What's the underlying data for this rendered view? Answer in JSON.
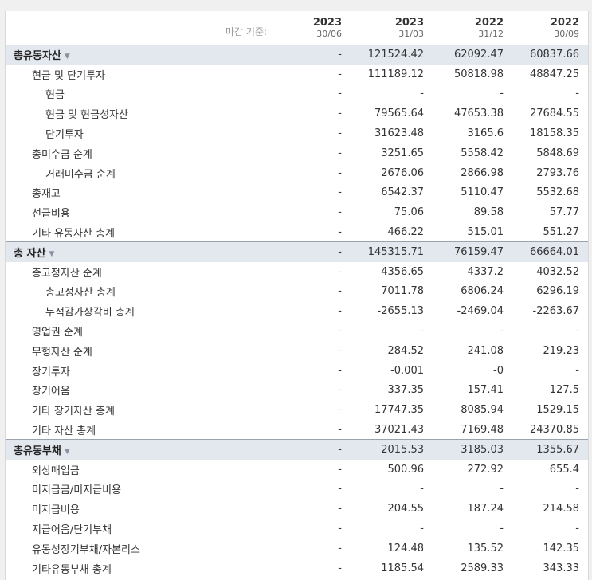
{
  "header": {
    "basis_label": "마감 기준:",
    "columns": [
      {
        "year": "2023",
        "date": "30/06"
      },
      {
        "year": "2023",
        "date": "31/03"
      },
      {
        "year": "2022",
        "date": "31/12"
      },
      {
        "year": "2022",
        "date": "30/09"
      }
    ]
  },
  "rows": [
    {
      "label": "총유동자산",
      "level": 0,
      "values": [
        "-",
        "121524.42",
        "62092.47",
        "60837.66"
      ]
    },
    {
      "label": "현금 및 단기투자",
      "level": 1,
      "values": [
        "-",
        "111189.12",
        "50818.98",
        "48847.25"
      ]
    },
    {
      "label": "현금",
      "level": 2,
      "values": [
        "-",
        "-",
        "-",
        "-"
      ]
    },
    {
      "label": "현금 및 현금성자산",
      "level": 2,
      "values": [
        "-",
        "79565.64",
        "47653.38",
        "27684.55"
      ]
    },
    {
      "label": "단기투자",
      "level": 2,
      "values": [
        "-",
        "31623.48",
        "3165.6",
        "18158.35"
      ]
    },
    {
      "label": "총미수금 순계",
      "level": 1,
      "values": [
        "-",
        "3251.65",
        "5558.42",
        "5848.69"
      ]
    },
    {
      "label": "거래미수금 순계",
      "level": 2,
      "values": [
        "-",
        "2676.06",
        "2866.98",
        "2793.76"
      ]
    },
    {
      "label": "총재고",
      "level": 1,
      "values": [
        "-",
        "6542.37",
        "5110.47",
        "5532.68"
      ]
    },
    {
      "label": "선급비용",
      "level": 1,
      "values": [
        "-",
        "75.06",
        "89.58",
        "57.77"
      ]
    },
    {
      "label": "기타 유동자산 총계",
      "level": 1,
      "values": [
        "-",
        "466.22",
        "515.01",
        "551.27"
      ]
    },
    {
      "label": "총 자산",
      "level": 0,
      "values": [
        "-",
        "145315.71",
        "76159.47",
        "66664.01"
      ]
    },
    {
      "label": "총고정자산 순계",
      "level": 1,
      "values": [
        "-",
        "4356.65",
        "4337.2",
        "4032.52"
      ]
    },
    {
      "label": "총고정자산 총계",
      "level": 2,
      "values": [
        "-",
        "7011.78",
        "6806.24",
        "6296.19"
      ]
    },
    {
      "label": "누적감가상각비 총계",
      "level": 2,
      "values": [
        "-",
        "-2655.13",
        "-2469.04",
        "-2263.67"
      ]
    },
    {
      "label": "영업권 순계",
      "level": 1,
      "values": [
        "-",
        "-",
        "-",
        "-"
      ]
    },
    {
      "label": "무형자산 순계",
      "level": 1,
      "values": [
        "-",
        "284.52",
        "241.08",
        "219.23"
      ]
    },
    {
      "label": "장기투자",
      "level": 1,
      "values": [
        "-",
        "-0.001",
        "-0",
        "-"
      ]
    },
    {
      "label": "장기어음",
      "level": 1,
      "values": [
        "-",
        "337.35",
        "157.41",
        "127.5"
      ]
    },
    {
      "label": "기타 장기자산 총계",
      "level": 1,
      "values": [
        "-",
        "17747.35",
        "8085.94",
        "1529.15"
      ]
    },
    {
      "label": "기타 자산 총계",
      "level": 1,
      "values": [
        "-",
        "37021.43",
        "7169.48",
        "24370.85"
      ]
    },
    {
      "label": "총유동부채",
      "level": 0,
      "values": [
        "-",
        "2015.53",
        "3185.03",
        "1355.67"
      ]
    },
    {
      "label": "외상매입금",
      "level": 1,
      "values": [
        "-",
        "500.96",
        "272.92",
        "655.4"
      ]
    },
    {
      "label": "미지급금/미지급비용",
      "level": 1,
      "values": [
        "-",
        "-",
        "-",
        "-"
      ]
    },
    {
      "label": "미지급비용",
      "level": 1,
      "values": [
        "-",
        "204.55",
        "187.24",
        "214.58"
      ]
    },
    {
      "label": "지급어음/단기부채",
      "level": 1,
      "values": [
        "-",
        "-",
        "-",
        "-"
      ]
    },
    {
      "label": "유동성장기부채/자본리스",
      "level": 1,
      "values": [
        "-",
        "124.48",
        "135.52",
        "142.35"
      ]
    },
    {
      "label": "기타유동부채 총계",
      "level": 1,
      "values": [
        "-",
        "1185.54",
        "2589.33",
        "343.33"
      ]
    }
  ],
  "icons": {
    "section_toggle": "chevron-down-icon"
  },
  "colors": {
    "section_bg": "#e3e8ef",
    "divider": "#9aa3ad"
  }
}
